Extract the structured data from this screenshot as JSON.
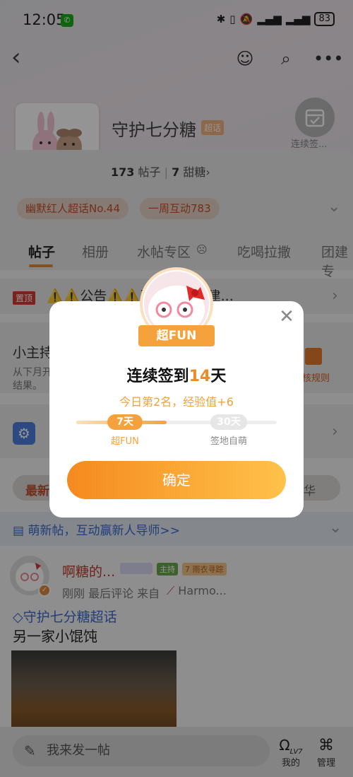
{
  "status_bar": {
    "time": "12:05",
    "battery": "83"
  },
  "header": {
    "forum_name": "守护七分糖",
    "super_tag": "超话",
    "checkin_label": "连续签..."
  },
  "stats": {
    "posts_count": "173",
    "posts_label": "帖子",
    "sugar_count": "7",
    "sugar_label": "甜糖"
  },
  "badges": [
    "幽默红人超话No.44",
    "一周互动783"
  ],
  "tabs": [
    "帖子",
    "相册",
    "水帖专区",
    "吃喝拉撒",
    "团建专"
  ],
  "pinned": {
    "tag": "置顶",
    "text": "⚠️⚠️公告⚠️⚠️到通知，封建..."
  },
  "moderator": {
    "title": "小主持",
    "desc_line1": "从下月开",
    "desc_line2": "结果。",
    "rules": "核规则"
  },
  "filter": {
    "left": "最新",
    "right": "华"
  },
  "mentor_banner": "萌新帖，互动赢新人导师>>",
  "post": {
    "username": "啊糖的...",
    "chip_host": "主持",
    "chip_level": "7",
    "chip_rain": "雨衣寻踪",
    "meta": "刚刚 最后评论  来自",
    "device": "Harmo...",
    "forum_link": "守护七分糖超话",
    "title": "另一家小馄饨"
  },
  "bottom_bar": {
    "compose_placeholder": "我来发一帖",
    "mine_label": "我的",
    "manage_label": "管理",
    "level": "LV7"
  },
  "dialog": {
    "ribbon": "超FUN",
    "title_prefix": "连续签到",
    "days": "14",
    "title_suffix": "天",
    "subtitle": "今日第2名，经验值+6",
    "progress": 0.45,
    "milestone_1_value": "7天",
    "milestone_1_label": "超FUN",
    "milestone_2_value": "30天",
    "milestone_2_label": "签地自萌",
    "confirm": "确定"
  },
  "colors": {
    "accent": "#f5a23c",
    "link": "#3b6bd1",
    "danger": "#d23c32"
  }
}
